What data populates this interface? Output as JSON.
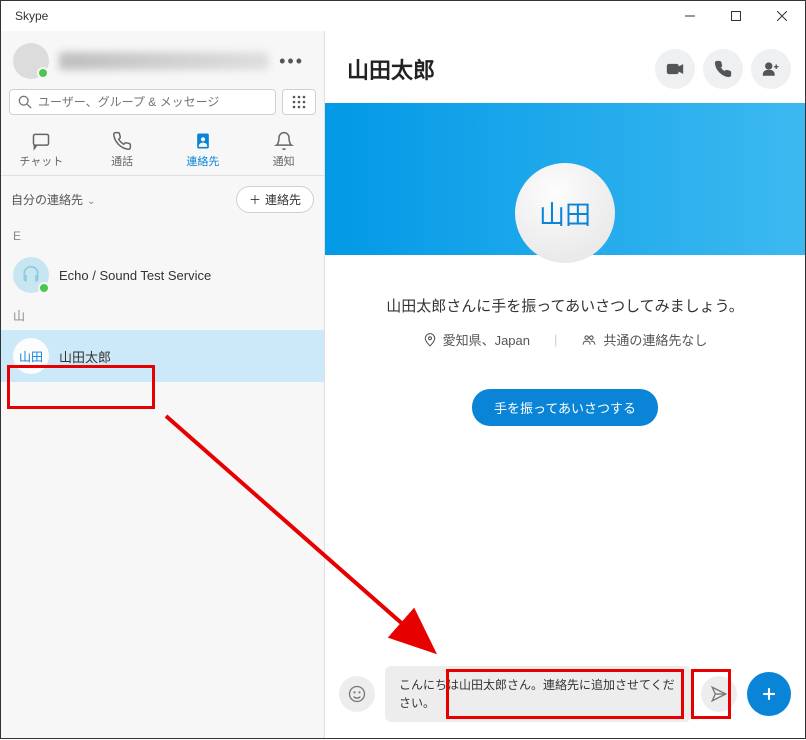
{
  "app": {
    "title": "Skype"
  },
  "search": {
    "placeholder": "ユーザー、グループ & メッセージ"
  },
  "tabs": {
    "chat": "チャット",
    "call": "通話",
    "contacts": "連絡先",
    "notify": "通知"
  },
  "filter": {
    "label": "自分の連絡先",
    "add_contact": "連絡先"
  },
  "groups": {
    "e": "E",
    "yama": "山"
  },
  "contacts": {
    "echo": "Echo / Sound Test Service",
    "yamada_avatar": "山田",
    "yamada_name": "山田太郎"
  },
  "header": {
    "title": "山田太郎"
  },
  "hero": {
    "avatar_label": "山田"
  },
  "greeting": "山田太郎さんに手を振ってあいさつしてみましょう。",
  "meta": {
    "location": "愛知県、Japan",
    "mutual": "共通の連絡先なし"
  },
  "wave_button": "手を振ってあいさつする",
  "compose": {
    "message": "こんにちは山田太郎さん。連絡先に追加させてください。"
  }
}
